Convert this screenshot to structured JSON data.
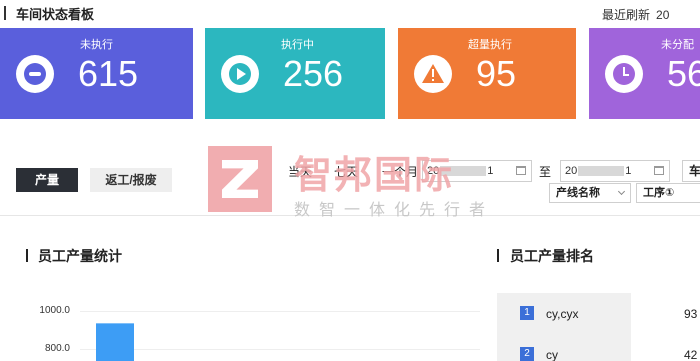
{
  "header": {
    "title": "车间状态看板",
    "refresh_label": "最近刷新",
    "refresh_value": "20"
  },
  "cards": [
    {
      "label": "未执行",
      "value": "615",
      "icon": "minus-circle-icon",
      "color": "#5a5fdc"
    },
    {
      "label": "执行中",
      "value": "256",
      "icon": "play-circle-icon",
      "color": "#2cb7bf"
    },
    {
      "label": "超量执行",
      "value": "95",
      "icon": "warning-icon",
      "color": "#f07a36"
    },
    {
      "label": "未分配",
      "value": "56",
      "icon": "clock-icon",
      "color": "#a064db"
    }
  ],
  "filters": {
    "tabs": [
      "产量",
      "返工/报废"
    ],
    "quick_ranges": [
      "当天",
      "七天",
      "一个月"
    ],
    "date_from": {
      "prefix": "20",
      "suffix": "1"
    },
    "to_label": "至",
    "date_to": {
      "prefix": "20",
      "suffix": "1"
    },
    "cut_label": "车",
    "line_select": "产线名称",
    "process_select": "工序①"
  },
  "watermark": {
    "main": "智邦国际",
    "sub": "数智一体化先行者"
  },
  "sections": {
    "stats_title": "员工产量统计",
    "ranking_title": "员工产量排名"
  },
  "chart_data": {
    "type": "bar",
    "title": "员工产量统计",
    "ylabels": [
      "1000.0",
      "800.0"
    ],
    "ylim": [
      0,
      1000
    ],
    "categories": [
      "cy,cyx"
    ],
    "values": [
      935
    ],
    "color": "#3d9df5"
  },
  "ranking": [
    {
      "rank": "1",
      "name": "cy,cyx",
      "value": "93"
    },
    {
      "rank": "2",
      "name": "cy",
      "value": "42"
    }
  ]
}
